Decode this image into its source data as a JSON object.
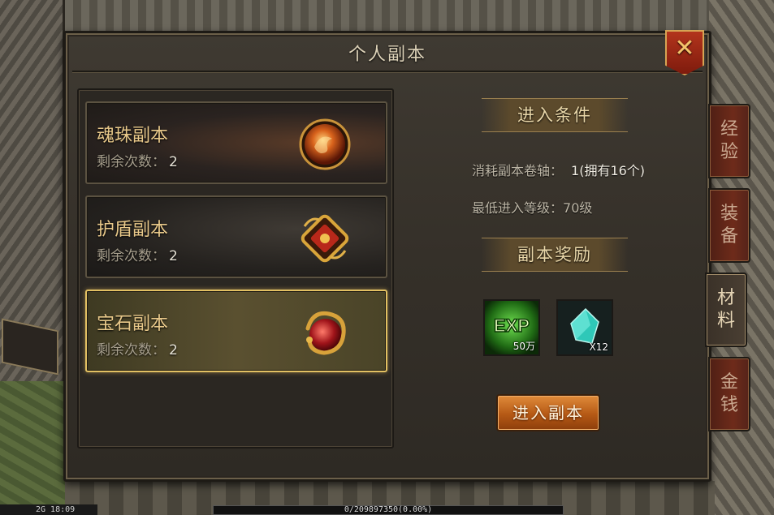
{
  "panel": {
    "title": "个人副本",
    "close_label": "✕"
  },
  "dungeons": [
    {
      "name": "魂珠副本",
      "count_label": "剩余次数：",
      "count": "2",
      "icon": "fire-orb-icon",
      "selected": false
    },
    {
      "name": "护盾副本",
      "count_label": "剩余次数：",
      "count": "2",
      "icon": "golden-shield-icon",
      "selected": false
    },
    {
      "name": "宝石副本",
      "count_label": "剩余次数：",
      "count": "2",
      "icon": "dragon-gem-icon",
      "selected": true
    }
  ],
  "conditions": {
    "header": "进入条件",
    "scroll_label": "消耗副本卷轴：",
    "scroll_value": "1(拥有16个)",
    "level_label": "最低进入等级：",
    "level_value": "70级"
  },
  "rewards": {
    "header": "副本奖励",
    "items": [
      {
        "icon": "exp-icon",
        "icon_text": "EXP",
        "caption": "50万"
      },
      {
        "icon": "crystal-icon",
        "caption": "X12"
      }
    ]
  },
  "enter_button": "进入副本",
  "side_tabs": [
    {
      "label": "经验",
      "active": false
    },
    {
      "label": "装备",
      "active": false
    },
    {
      "label": "材料",
      "active": true
    },
    {
      "label": "金钱",
      "active": false
    }
  ],
  "status": {
    "time": "2G 18:09",
    "exp": "0/209897350(0.00%)"
  },
  "colors": {
    "accent_gold": "#e9c98a",
    "button_orange": "#b55915",
    "close_red": "#b3341c"
  }
}
